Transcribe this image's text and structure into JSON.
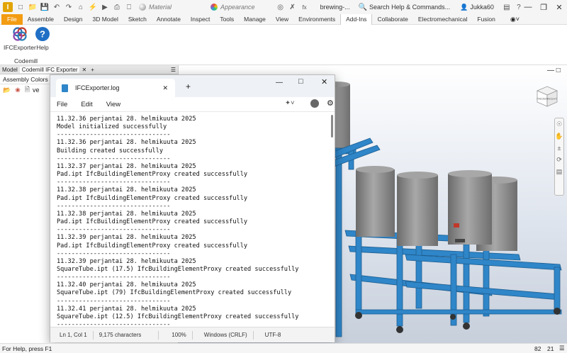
{
  "app": {
    "document_title": "brewing-...",
    "material_placeholder": "Material",
    "appearance_placeholder": "Appearance",
    "search_placeholder": "Search Help & Commands...",
    "user_name": "Jukka60"
  },
  "ribbon": {
    "tabs": [
      "File",
      "Assemble",
      "Design",
      "3D Model",
      "Sketch",
      "Annotate",
      "Inspect",
      "Tools",
      "Manage",
      "View",
      "Environments",
      "Add-Ins",
      "Collaborate",
      "Electromechanical",
      "Fusion"
    ],
    "active_tab": "Add-Ins",
    "buttons": [
      {
        "label": "IFCExporter",
        "icon": "ifc-exporter-icon"
      },
      {
        "label": "Help",
        "icon": "help-icon"
      }
    ],
    "panel_name": "Codemill"
  },
  "browser": {
    "tabs": [
      "Model",
      "Codemill IFC Exporter"
    ],
    "subheader": "Assembly Colors",
    "sub_letter": "A",
    "item_text": "ve"
  },
  "notepad": {
    "tab_title": "IFCExporter.log",
    "menu": [
      "File",
      "Edit",
      "View"
    ],
    "lines": [
      "11.32.36 perjantai 28. helmikuuta 2025",
      "Model initialized successfully",
      "-------------------------------",
      "11.32.36 perjantai 28. helmikuuta 2025",
      "Building created successfully",
      "-------------------------------",
      "11.32.37 perjantai 28. helmikuuta 2025",
      "Pad.ipt IfcBuildingElementProxy created successfully",
      "-------------------------------",
      "11.32.38 perjantai 28. helmikuuta 2025",
      "Pad.ipt IfcBuildingElementProxy created successfully",
      "-------------------------------",
      "11.32.38 perjantai 28. helmikuuta 2025",
      "Pad.ipt IfcBuildingElementProxy created successfully",
      "-------------------------------",
      "11.32.39 perjantai 28. helmikuuta 2025",
      "Pad.ipt IfcBuildingElementProxy created successfully",
      "-------------------------------",
      "11.32.39 perjantai 28. helmikuuta 2025",
      "SquareTube.ipt (17.5) IfcBuildingElementProxy created successfully",
      "-------------------------------",
      "11.32.40 perjantai 28. helmikuuta 2025",
      "SquareTube.ipt (79) IfcBuildingElementProxy created successfully",
      "-------------------------------",
      "11.32.41 perjantai 28. helmikuuta 2025",
      "SquareTube.ipt (12.5) IfcBuildingElementProxy created successfully",
      "-------------------------------"
    ],
    "status": {
      "position": "Ln 1, Col 1",
      "characters": "9,175 characters",
      "zoom": "100%",
      "line_ending": "Windows (CRLF)",
      "encoding": "UTF-8"
    }
  },
  "statusbar": {
    "help_text": "For Help, press F1",
    "count_a": "82",
    "count_b": "21"
  },
  "viewcube": {
    "front": "FRONT",
    "right": "RIGHT"
  }
}
